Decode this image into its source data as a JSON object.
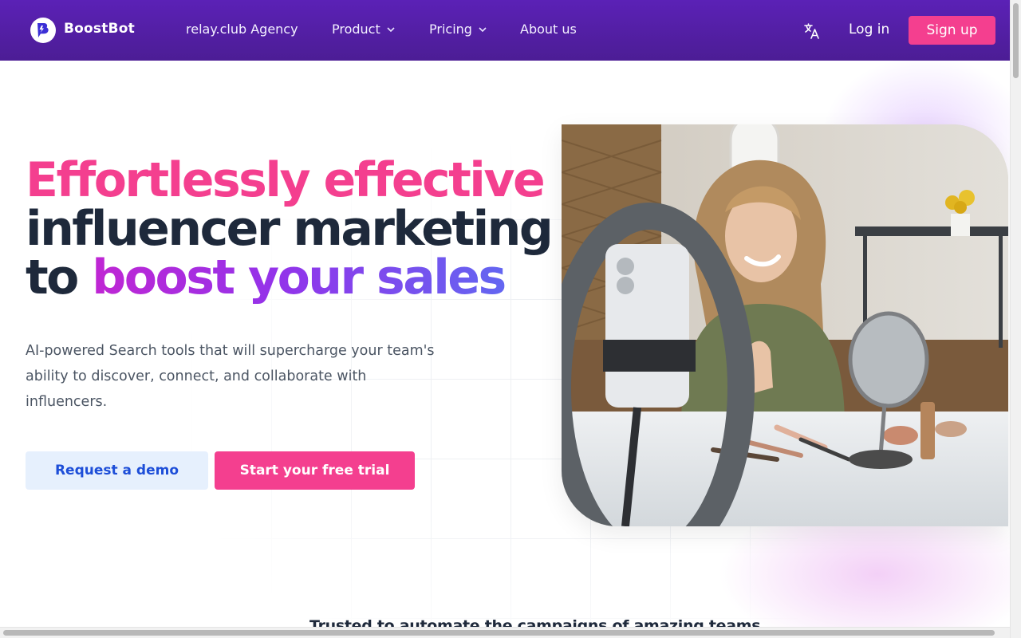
{
  "header": {
    "brand": "BoostBot",
    "nav": [
      {
        "label": "relay.club Agency"
      },
      {
        "label": "Product"
      },
      {
        "label": "Pricing"
      },
      {
        "label": "About us"
      }
    ],
    "login_label": "Log in",
    "signup_label": "Sign up"
  },
  "hero": {
    "headline_line1": "Effortlessly effective",
    "headline_line2": "influencer marketing",
    "headline_line3_prefix": "to ",
    "headline_line3_gradient": "boost your sales",
    "subtitle": "AI-powered Search tools that will supercharge your team's ability to discover, connect, and collaborate with influencers.",
    "demo_button": "Request a demo",
    "trial_button": "Start your free trial"
  },
  "trusted_text": "Trusted to automate the campaigns of amazing teams",
  "icons": {
    "logo": "boostbot-logo-icon",
    "language": "translate-icon",
    "chevron": "chevron-down-icon"
  },
  "colors": {
    "header_bg": "#4c1d95",
    "accent_pink": "#f43f8f",
    "demo_bg": "#e6f0fd",
    "demo_text": "#1d4ed8",
    "headline_dark": "#1e293b",
    "gradient_start": "#c026d3",
    "gradient_end": "#6366f1"
  }
}
